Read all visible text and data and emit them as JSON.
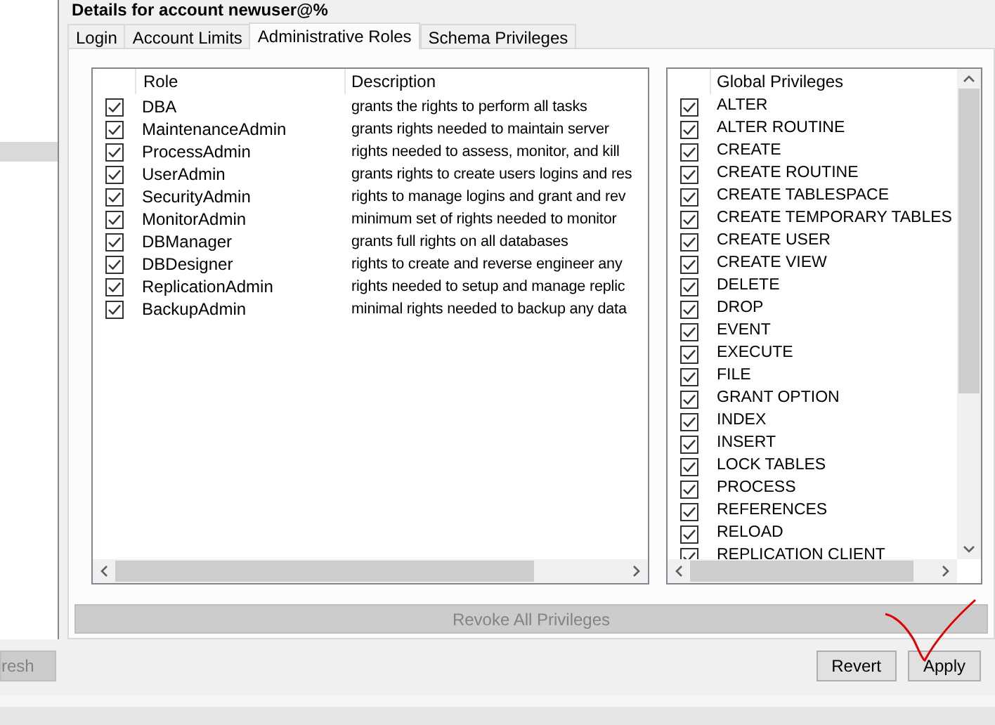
{
  "title": "Details for account newuser@%",
  "tabs": [
    {
      "label": "Login",
      "selected": false
    },
    {
      "label": "Account Limits",
      "selected": false
    },
    {
      "label": "Administrative Roles",
      "selected": true
    },
    {
      "label": "Schema Privileges",
      "selected": false
    }
  ],
  "roles": {
    "columns": [
      "Role",
      "Description"
    ],
    "rows": [
      {
        "role": "DBA",
        "description": "grants the rights to perform all tasks",
        "checked": true
      },
      {
        "role": "MaintenanceAdmin",
        "description": "grants rights needed to maintain server",
        "checked": true
      },
      {
        "role": "ProcessAdmin",
        "description": "rights needed to assess, monitor, and kill",
        "checked": true
      },
      {
        "role": "UserAdmin",
        "description": "grants rights to create users logins and res",
        "checked": true
      },
      {
        "role": "SecurityAdmin",
        "description": "rights to manage logins and grant and rev",
        "checked": true
      },
      {
        "role": "MonitorAdmin",
        "description": "minimum set of rights needed to monitor",
        "checked": true
      },
      {
        "role": "DBManager",
        "description": "grants full rights on all databases",
        "checked": true
      },
      {
        "role": "DBDesigner",
        "description": "rights to create and reverse engineer any",
        "checked": true
      },
      {
        "role": "ReplicationAdmin",
        "description": "rights needed to setup and manage replic",
        "checked": true
      },
      {
        "role": "BackupAdmin",
        "description": "minimal rights needed to backup any data",
        "checked": true
      }
    ]
  },
  "privileges": {
    "column": "Global Privileges",
    "rows": [
      {
        "name": "ALTER",
        "checked": true
      },
      {
        "name": "ALTER ROUTINE",
        "checked": true
      },
      {
        "name": "CREATE",
        "checked": true
      },
      {
        "name": "CREATE ROUTINE",
        "checked": true
      },
      {
        "name": "CREATE TABLESPACE",
        "checked": true
      },
      {
        "name": "CREATE TEMPORARY TABLES",
        "checked": true
      },
      {
        "name": "CREATE USER",
        "checked": true
      },
      {
        "name": "CREATE VIEW",
        "checked": true
      },
      {
        "name": "DELETE",
        "checked": true
      },
      {
        "name": "DROP",
        "checked": true
      },
      {
        "name": "EVENT",
        "checked": true
      },
      {
        "name": "EXECUTE",
        "checked": true
      },
      {
        "name": "FILE",
        "checked": true
      },
      {
        "name": "GRANT OPTION",
        "checked": true
      },
      {
        "name": "INDEX",
        "checked": true
      },
      {
        "name": "INSERT",
        "checked": true
      },
      {
        "name": "LOCK TABLES",
        "checked": true
      },
      {
        "name": "PROCESS",
        "checked": true
      },
      {
        "name": "REFERENCES",
        "checked": true
      },
      {
        "name": "RELOAD",
        "checked": true
      },
      {
        "name": "REPLICATION CLIENT",
        "checked": true
      }
    ]
  },
  "revoke_button": {
    "label": "Revoke All Privileges",
    "disabled": true
  },
  "refresh_button": {
    "label": "resh"
  },
  "buttons": [
    "Revert",
    "Apply"
  ]
}
